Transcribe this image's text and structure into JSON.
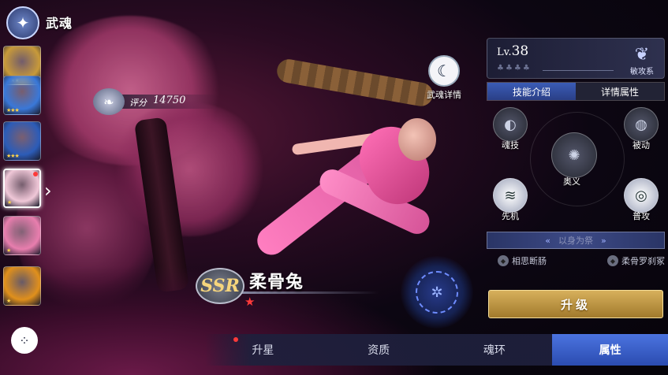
{
  "header": {
    "title": "武魂"
  },
  "roster": [
    {
      "stars": "★★★",
      "color": "#c89a3a",
      "selected": false,
      "dot": false
    },
    {
      "stars": "★★★",
      "color": "#3a78d8",
      "selected": false,
      "dot": false
    },
    {
      "stars": "★★★",
      "color": "#2c5cb8",
      "selected": false,
      "dot": false
    },
    {
      "stars": "★",
      "color": "#f0c8d8",
      "selected": true,
      "dot": true
    },
    {
      "stars": "★",
      "color": "#e87eae",
      "selected": false,
      "dot": false
    },
    {
      "stars": "★",
      "color": "#e0901c",
      "selected": false,
      "dot": false
    }
  ],
  "score": {
    "label": "评分",
    "value": "14750"
  },
  "detail_button": {
    "label": "武魂详情"
  },
  "hero": {
    "rarity": "SSR",
    "name": "柔骨兔",
    "star": "★"
  },
  "panel": {
    "level": "38",
    "level_prefix": "Lv.",
    "spirit_type": "敏攻系",
    "tabs": [
      "技能介绍",
      "详情属性"
    ],
    "active_tab": 0,
    "skills": {
      "soul": "魂技",
      "passive": "被动",
      "ultimate": "奥义",
      "first": "先机",
      "normal": "普攻"
    },
    "passive_title": "以身为祭",
    "talents": [
      "相思断肠",
      "柔骨罗刹冢"
    ],
    "upgrade": "升级"
  },
  "bottom_tabs": [
    "升星",
    "资质",
    "魂环",
    "属性"
  ],
  "active_bottom_tab": 3
}
